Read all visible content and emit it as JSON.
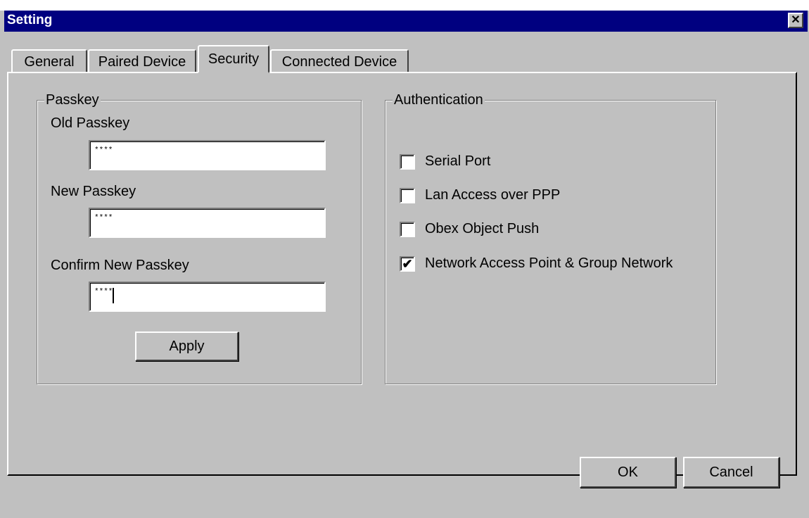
{
  "window": {
    "title": "Setting",
    "close_glyph": "✕"
  },
  "tabs": [
    {
      "label": "General",
      "active": false
    },
    {
      "label": "Paired Device",
      "active": false
    },
    {
      "label": "Security",
      "active": true
    },
    {
      "label": "Connected Device",
      "active": false
    }
  ],
  "passkey": {
    "group_label": "Passkey",
    "old_label": "Old Passkey",
    "old_value": "****",
    "new_label": "New Passkey",
    "new_value": "****",
    "confirm_label": "Confirm New Passkey",
    "confirm_value": "****",
    "apply_label": "Apply"
  },
  "authentication": {
    "group_label": "Authentication",
    "items": [
      {
        "label": "Serial Port",
        "checked": false,
        "mark": ""
      },
      {
        "label": "Lan Access over PPP",
        "checked": false,
        "mark": ""
      },
      {
        "label": "Obex Object Push",
        "checked": false,
        "mark": ""
      },
      {
        "label": "Network Access Point & Group Network",
        "checked": true,
        "mark": "✔"
      }
    ]
  },
  "footer": {
    "ok_label": "OK",
    "cancel_label": "Cancel"
  },
  "colors": {
    "title_bar": "#000080",
    "face": "#c0c0c0"
  }
}
